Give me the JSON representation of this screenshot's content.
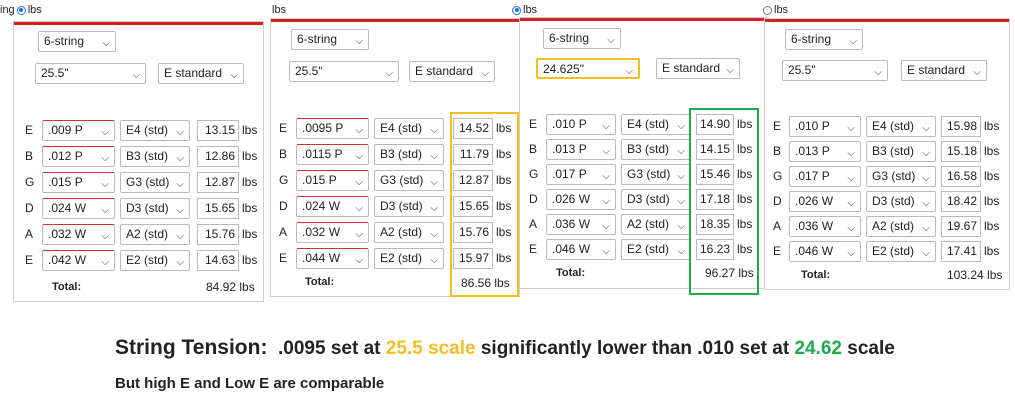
{
  "colors": {
    "red_bar": "#d42020",
    "yellow": "#f3be22",
    "green": "#1faa4e",
    "radio": "#1a73e8"
  },
  "panels": [
    {
      "unit_text": "ing",
      "radio_text": "lbs",
      "string_count": "6-string",
      "scale": "25.5\"",
      "tuning": "E standard",
      "strings": [
        {
          "name": "E",
          "gauge": ".009 P",
          "note": "E4 (std)",
          "tension": "13.15",
          "unit": "lbs"
        },
        {
          "name": "B",
          "gauge": ".012 P",
          "note": "B3 (std)",
          "tension": "12.86",
          "unit": "lbs"
        },
        {
          "name": "G",
          "gauge": ".015 P",
          "note": "G3 (std)",
          "tension": "12.87",
          "unit": "lbs"
        },
        {
          "name": "D",
          "gauge": ".024 W",
          "note": "D3 (std)",
          "tension": "15.65",
          "unit": "lbs"
        },
        {
          "name": "A",
          "gauge": ".032 W",
          "note": "A2 (std)",
          "tension": "15.76",
          "unit": "lbs"
        },
        {
          "name": "E",
          "gauge": ".042 W",
          "note": "E2 (std)",
          "tension": "14.63",
          "unit": "lbs"
        }
      ],
      "total_label": "Total:",
      "total": "84.92 lbs"
    },
    {
      "radio_text": "lbs",
      "string_count": "6-string",
      "scale": "25.5\"",
      "tuning": "E standard",
      "strings": [
        {
          "name": "E",
          "gauge": ".0095 P",
          "note": "E4 (std)",
          "tension": "14.52",
          "unit": "lbs"
        },
        {
          "name": "B",
          "gauge": ".0115 P",
          "note": "B3 (std)",
          "tension": "11.79",
          "unit": "lbs"
        },
        {
          "name": "G",
          "gauge": ".015 P",
          "note": "G3 (std)",
          "tension": "12.87",
          "unit": "lbs"
        },
        {
          "name": "D",
          "gauge": ".024 W",
          "note": "D3 (std)",
          "tension": "15.65",
          "unit": "lbs"
        },
        {
          "name": "A",
          "gauge": ".032 W",
          "note": "A2 (std)",
          "tension": "15.76",
          "unit": "lbs"
        },
        {
          "name": "E",
          "gauge": ".044 W",
          "note": "E2 (std)",
          "tension": "15.97",
          "unit": "lbs"
        }
      ],
      "total_label": "Total:",
      "total": "86.56 lbs"
    },
    {
      "radio_text": "lbs",
      "string_count": "6-string",
      "scale": "24.625\"",
      "tuning": "E standard",
      "strings": [
        {
          "name": "E",
          "gauge": ".010 P",
          "note": "E4 (std)",
          "tension": "14.90",
          "unit": "lbs"
        },
        {
          "name": "B",
          "gauge": ".013 P",
          "note": "B3 (std)",
          "tension": "14.15",
          "unit": "lbs"
        },
        {
          "name": "G",
          "gauge": ".017 P",
          "note": "G3 (std)",
          "tension": "15.46",
          "unit": "lbs"
        },
        {
          "name": "D",
          "gauge": ".026 W",
          "note": "D3 (std)",
          "tension": "17.18",
          "unit": "lbs"
        },
        {
          "name": "A",
          "gauge": ".036 W",
          "note": "A2 (std)",
          "tension": "18.35",
          "unit": "lbs"
        },
        {
          "name": "E",
          "gauge": ".046 W",
          "note": "E2 (std)",
          "tension": "16.23",
          "unit": "lbs"
        }
      ],
      "total_label": "Total:",
      "total": "96.27 lbs"
    },
    {
      "radio_text": "lbs",
      "string_count": "6-string",
      "scale": "25.5\"",
      "tuning": "E standard",
      "strings": [
        {
          "name": "E",
          "gauge": ".010 P",
          "note": "E4 (std)",
          "tension": "15.98",
          "unit": "lbs"
        },
        {
          "name": "B",
          "gauge": ".013 P",
          "note": "B3 (std)",
          "tension": "15.18",
          "unit": "lbs"
        },
        {
          "name": "G",
          "gauge": ".017 P",
          "note": "G3 (std)",
          "tension": "16.58",
          "unit": "lbs"
        },
        {
          "name": "D",
          "gauge": ".026 W",
          "note": "D3 (std)",
          "tension": "18.42",
          "unit": "lbs"
        },
        {
          "name": "A",
          "gauge": ".036 W",
          "note": "A2 (std)",
          "tension": "19.67",
          "unit": "lbs"
        },
        {
          "name": "E",
          "gauge": ".046 W",
          "note": "E2 (std)",
          "tension": "17.41",
          "unit": "lbs"
        }
      ],
      "total_label": "Total:",
      "total": "103.24 lbs"
    }
  ],
  "caption": {
    "label": "String Tension:",
    "part1": ".0095 set at",
    "scale1": "25.5 scale",
    "part2": "significantly lower than .010 set at",
    "scale2": "24.62",
    "part3": "scale",
    "subtitle": "But high E and Low E are comparable"
  }
}
